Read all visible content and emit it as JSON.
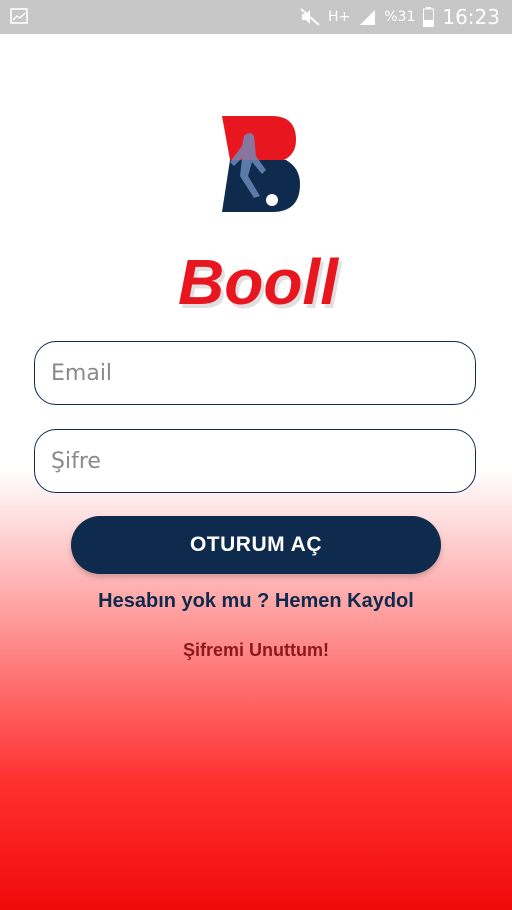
{
  "status_bar": {
    "battery_percent": "%31",
    "time": "16:23",
    "network_label": "H+",
    "icons": [
      "image-icon",
      "mute-icon",
      "network-h-plus-icon",
      "signal-icon",
      "battery-icon"
    ]
  },
  "brand": {
    "name": "Booll",
    "colors": {
      "navy": "#0e2a4d",
      "red": "#e8161f"
    }
  },
  "form": {
    "email_placeholder": "Email",
    "password_placeholder": "Şifre",
    "login_label": "OTURUM AÇ"
  },
  "links": {
    "signup": "Hesabın yok mu ? Hemen Kaydol",
    "forgot": "Şifremi Unuttum!"
  }
}
